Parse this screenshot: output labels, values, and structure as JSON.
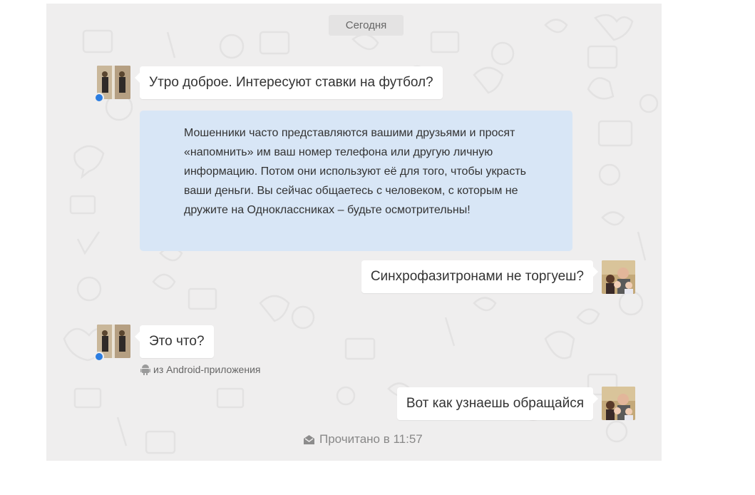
{
  "chat": {
    "date_divider": "Сегодня",
    "messages": [
      {
        "direction": "incoming",
        "text": "Утро доброе. Интересуют ставки на футбол?"
      },
      {
        "direction": "outgoing",
        "text": "Синхрофазитронами не торгуеш?"
      },
      {
        "direction": "incoming",
        "text": "Это что?"
      },
      {
        "direction": "outgoing",
        "text": "Вот как узнаешь обращайся"
      }
    ],
    "warning": "Мошенники часто представляются вашими друзьями и просят «напомнить» им ваш номер телефона или другую личную информацию. Потом они используют её для того, чтобы украсть ваши деньги. Вы сейчас общаетесь с человеком, с которым не дружите на Одноклассниках – будьте осмотрительны!",
    "source_note": "из Android-приложения",
    "source_icon": "android-icon",
    "read_status": "Прочитано в 11:57",
    "read_icon": "envelope-open-icon"
  },
  "colors": {
    "background": "#efeeee",
    "bubble": "#ffffff",
    "warning_bg": "#d8e6f6",
    "online_dot": "#2b7de1"
  }
}
